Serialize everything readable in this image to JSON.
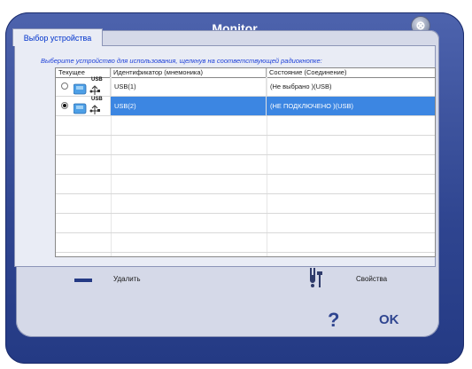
{
  "window": {
    "title": "Monitor",
    "close_glyph": "⊗"
  },
  "tab": {
    "label": "Выбор устройства"
  },
  "instruction": "Выберите устройство для использования, щелкнув на соответствующей радиокнопке:",
  "table": {
    "columns": [
      "Текущее",
      "Идентификатор (мнемоника)",
      "Состояние (Соединение)"
    ],
    "rows": [
      {
        "selected": false,
        "icon": "usb-device-icon",
        "icon_text": "USB",
        "identifier": "USB(1)",
        "state": "(Не выбрано )(USB)"
      },
      {
        "selected": true,
        "icon": "usb-device-icon",
        "icon_text": "USB",
        "identifier": "USB(2)",
        "state": "(НЕ ПОДКЛЮЧЕНО )(USB)"
      }
    ]
  },
  "buttons": {
    "delete_label": "Удалить",
    "properties_label": "Свойства",
    "help": "?",
    "ok": "OK"
  },
  "colors": {
    "frame": "#2f4590",
    "selection": "#3c86e2",
    "instruction": "#1c3fd8"
  }
}
